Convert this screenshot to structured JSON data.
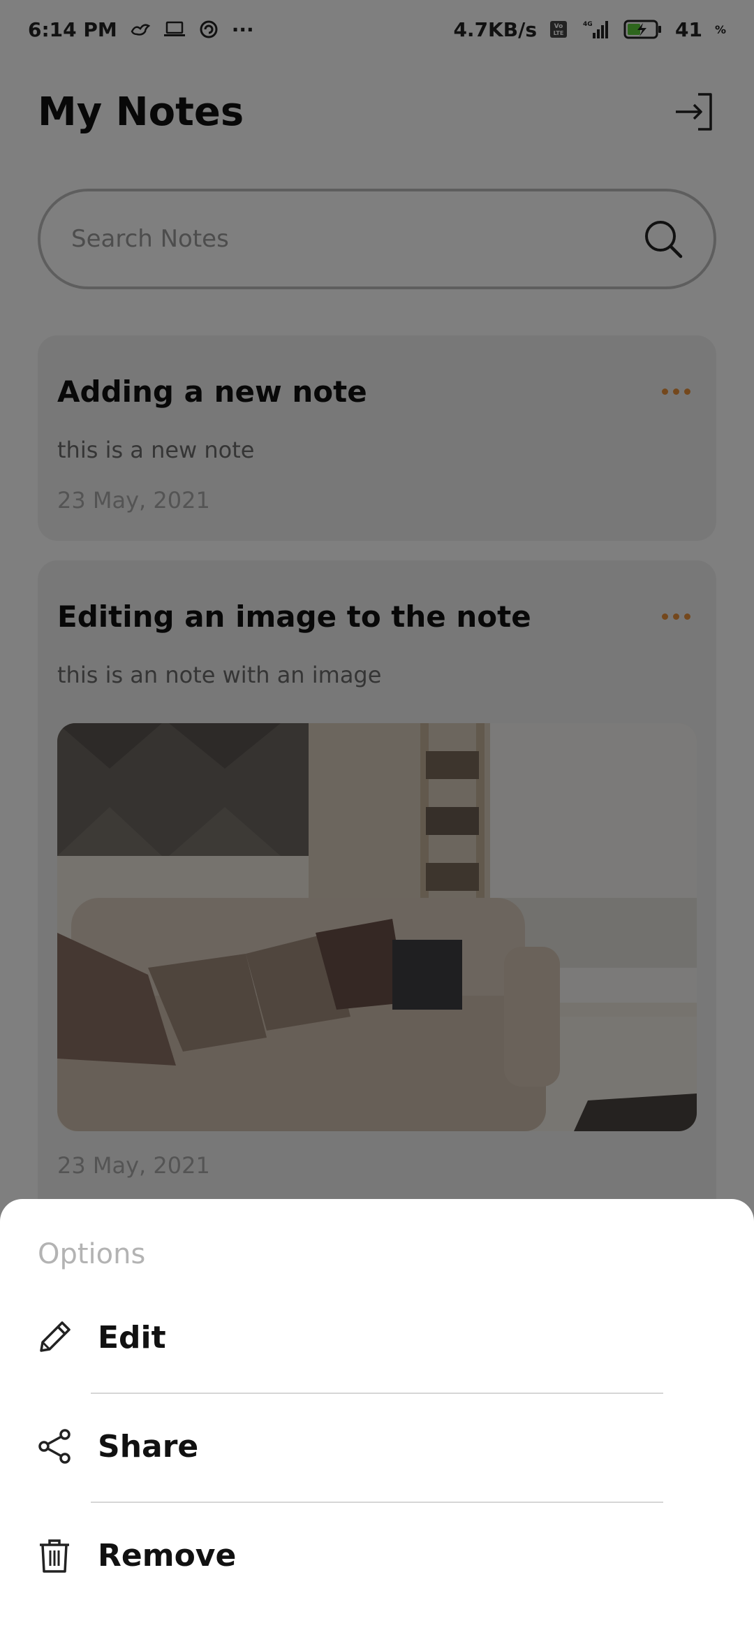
{
  "status_bar": {
    "time": "6:14 PM",
    "ellipsis": "···",
    "network_speed": "4.7KB/s",
    "volte": "Vo LTE",
    "signal_label": "4G",
    "battery": "41",
    "battery_unit": "%",
    "icons": [
      "bird-icon",
      "laptop-icon",
      "sync-icon",
      "signal-icon",
      "battery-charging-icon"
    ]
  },
  "header": {
    "title": "My Notes",
    "logout_icon": "logout-icon"
  },
  "search": {
    "placeholder": "Search Notes",
    "value": "",
    "icon": "search-icon"
  },
  "notes": [
    {
      "title": "Adding a new note",
      "body": "this is a new note",
      "date": "23 May, 2021"
    },
    {
      "title": "Editing an image to the note",
      "body": "this is an note with an image",
      "image": "living-room-sofa-photo",
      "date": "23 May, 2021"
    }
  ],
  "options_sheet": {
    "title": "Options",
    "items": [
      {
        "label": "Edit",
        "icon": "pencil-icon"
      },
      {
        "label": "Share",
        "icon": "share-icon"
      },
      {
        "label": "Remove",
        "icon": "trash-icon"
      }
    ]
  },
  "colors": {
    "accent": "#e8903a",
    "card_bg": "#f1f1f1",
    "scrim": "rgba(0,0,0,0.5)"
  }
}
